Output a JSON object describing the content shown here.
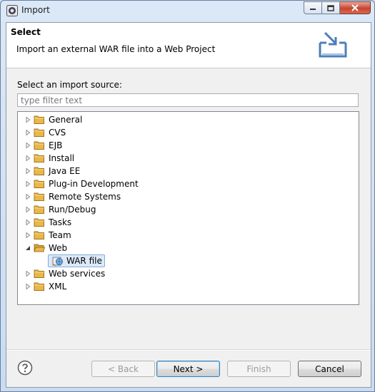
{
  "window": {
    "title": "Import"
  },
  "banner": {
    "title": "Select",
    "description": "Import an external WAR file into a Web Project"
  },
  "source": {
    "label": "Select an import source:",
    "filter_placeholder": "type filter text"
  },
  "tree": {
    "items": [
      {
        "label": "General",
        "expanded": false
      },
      {
        "label": "CVS",
        "expanded": false
      },
      {
        "label": "EJB",
        "expanded": false
      },
      {
        "label": "Install",
        "expanded": false
      },
      {
        "label": "Java EE",
        "expanded": false
      },
      {
        "label": "Plug-in Development",
        "expanded": false
      },
      {
        "label": "Remote Systems",
        "expanded": false
      },
      {
        "label": "Run/Debug",
        "expanded": false
      },
      {
        "label": "Tasks",
        "expanded": false
      },
      {
        "label": "Team",
        "expanded": false
      },
      {
        "label": "Web",
        "expanded": true
      },
      {
        "label": "WAR file",
        "selected": true,
        "child": true
      },
      {
        "label": "Web services",
        "expanded": false
      },
      {
        "label": "XML",
        "expanded": false
      }
    ]
  },
  "buttons": {
    "back": "< Back",
    "next": "Next >",
    "finish": "Finish",
    "cancel": "Cancel"
  },
  "colors": {
    "selection_bg": "#dbe9f8",
    "selection_border": "#84acdd",
    "folder": "#e8b84a"
  }
}
